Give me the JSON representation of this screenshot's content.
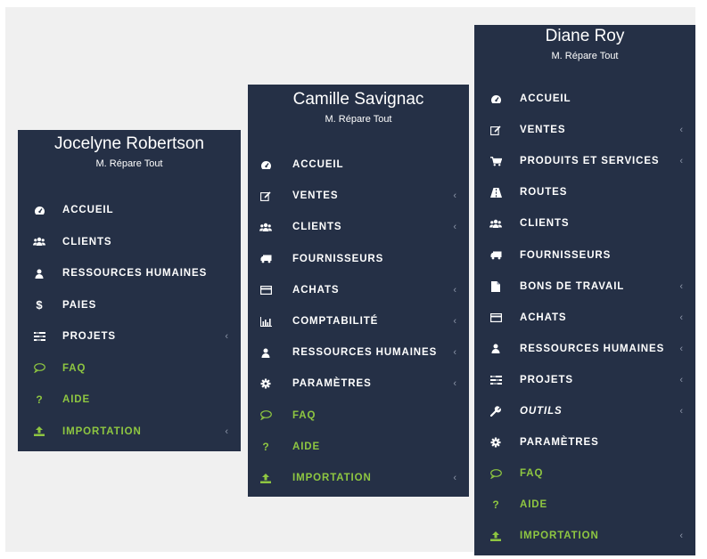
{
  "panels": [
    {
      "name": "Jocelyne Robertson",
      "company": "M. Répare Tout",
      "items": [
        {
          "label": "ACCUEIL",
          "icon": "dashboard-icon",
          "chevron": false,
          "accent": false
        },
        {
          "label": "CLIENTS",
          "icon": "users-icon",
          "chevron": false,
          "accent": false
        },
        {
          "label": "RESSOURCES HUMAINES",
          "icon": "user-icon",
          "chevron": false,
          "accent": false
        },
        {
          "label": "PAIES",
          "icon": "dollar-icon",
          "chevron": false,
          "accent": false
        },
        {
          "label": "PROJETS",
          "icon": "tasks-icon",
          "chevron": true,
          "accent": false
        },
        {
          "label": "FAQ",
          "icon": "comment-icon",
          "chevron": false,
          "accent": true
        },
        {
          "label": "AIDE",
          "icon": "question-icon",
          "chevron": false,
          "accent": true
        },
        {
          "label": "IMPORTATION",
          "icon": "upload-icon",
          "chevron": true,
          "accent": true
        }
      ]
    },
    {
      "name": "Camille Savignac",
      "company": "M. Répare Tout",
      "items": [
        {
          "label": "ACCUEIL",
          "icon": "dashboard-icon",
          "chevron": false,
          "accent": false
        },
        {
          "label": "VENTES",
          "icon": "edit-icon",
          "chevron": true,
          "accent": false
        },
        {
          "label": "CLIENTS",
          "icon": "users-icon",
          "chevron": true,
          "accent": false
        },
        {
          "label": "FOURNISSEURS",
          "icon": "truck-icon",
          "chevron": false,
          "accent": false
        },
        {
          "label": "ACHATS",
          "icon": "credit-card-icon",
          "chevron": true,
          "accent": false
        },
        {
          "label": "COMPTABILITÉ",
          "icon": "bar-chart-icon",
          "chevron": true,
          "accent": false
        },
        {
          "label": "RESSOURCES HUMAINES",
          "icon": "user-icon",
          "chevron": true,
          "accent": false
        },
        {
          "label": "PARAMÈTRES",
          "icon": "gear-icon",
          "chevron": true,
          "accent": false
        },
        {
          "label": "FAQ",
          "icon": "comment-icon",
          "chevron": false,
          "accent": true
        },
        {
          "label": "AIDE",
          "icon": "question-icon",
          "chevron": false,
          "accent": true
        },
        {
          "label": "IMPORTATION",
          "icon": "upload-icon",
          "chevron": true,
          "accent": true
        }
      ]
    },
    {
      "name": "Diane Roy",
      "company": "M. Répare Tout",
      "items": [
        {
          "label": "ACCUEIL",
          "icon": "dashboard-icon",
          "chevron": false,
          "accent": false
        },
        {
          "label": "VENTES",
          "icon": "edit-icon",
          "chevron": true,
          "accent": false
        },
        {
          "label": "PRODUITS ET SERVICES",
          "icon": "cart-icon",
          "chevron": true,
          "accent": false
        },
        {
          "label": "ROUTES",
          "icon": "road-icon",
          "chevron": false,
          "accent": false
        },
        {
          "label": "CLIENTS",
          "icon": "users-icon",
          "chevron": false,
          "accent": false
        },
        {
          "label": "FOURNISSEURS",
          "icon": "truck-icon",
          "chevron": false,
          "accent": false
        },
        {
          "label": "BONS DE TRAVAIL",
          "icon": "file-icon",
          "chevron": true,
          "accent": false
        },
        {
          "label": "ACHATS",
          "icon": "credit-card-icon",
          "chevron": true,
          "accent": false
        },
        {
          "label": "RESSOURCES HUMAINES",
          "icon": "user-icon",
          "chevron": true,
          "accent": false
        },
        {
          "label": "PROJETS",
          "icon": "tasks-icon",
          "chevron": true,
          "accent": false
        },
        {
          "label": "OUTILS",
          "icon": "wrench-icon",
          "chevron": true,
          "accent": false
        },
        {
          "label": "PARAMÈTRES",
          "icon": "gear-icon",
          "chevron": false,
          "accent": false
        },
        {
          "label": "FAQ",
          "icon": "comment-icon",
          "chevron": false,
          "accent": true
        },
        {
          "label": "AIDE",
          "icon": "question-icon",
          "chevron": false,
          "accent": true
        },
        {
          "label": "IMPORTATION",
          "icon": "upload-icon",
          "chevron": true,
          "accent": true
        }
      ]
    }
  ],
  "colors": {
    "panel_bg": "#253046",
    "accent": "#8ec641",
    "chevron": "#8c95a8"
  }
}
